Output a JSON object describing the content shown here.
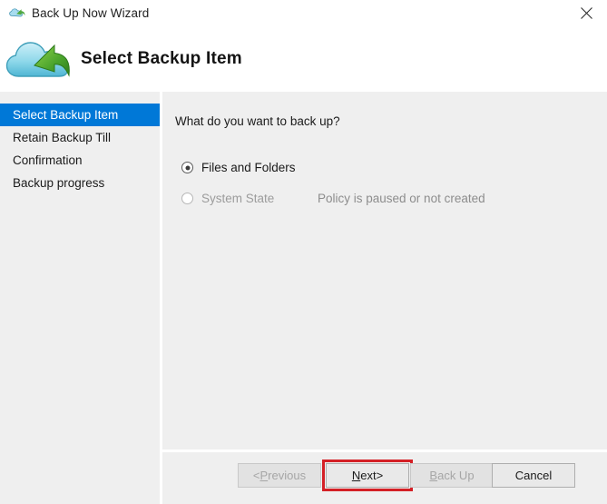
{
  "window": {
    "title": "Back Up Now Wizard",
    "title_icon": "cloud-backup-icon",
    "close_icon": "close-icon"
  },
  "header": {
    "icon": "cloud-download-arrow-icon",
    "title": "Select Backup Item"
  },
  "sidebar": {
    "active_index": 0,
    "items": [
      {
        "label": "Select Backup Item",
        "active": true
      },
      {
        "label": "Retain Backup Till",
        "active": false
      },
      {
        "label": "Confirmation",
        "active": false
      },
      {
        "label": "Backup progress",
        "active": false
      }
    ]
  },
  "content": {
    "question": "What do you want to back up?",
    "options": [
      {
        "label": "Files and Folders",
        "selected": true,
        "disabled": false,
        "note": ""
      },
      {
        "label": "System State",
        "selected": false,
        "disabled": true,
        "note": "Policy is paused or not created"
      }
    ]
  },
  "footer": {
    "buttons": [
      {
        "name": "previous",
        "prefix": "< ",
        "mnemonic": "P",
        "rest": "revious",
        "suffix": "",
        "disabled": true,
        "highlighted": false
      },
      {
        "name": "next",
        "prefix": "",
        "mnemonic": "N",
        "rest": "ext",
        "suffix": " >",
        "disabled": false,
        "highlighted": true
      },
      {
        "name": "backup",
        "prefix": "",
        "mnemonic": "B",
        "rest": "ack Up",
        "suffix": "",
        "disabled": true,
        "highlighted": false
      },
      {
        "name": "cancel",
        "prefix": "",
        "mnemonic": "",
        "rest": "Cancel",
        "suffix": "",
        "disabled": false,
        "highlighted": false
      }
    ]
  },
  "colors": {
    "accent": "#0078d7",
    "panel": "#efefef",
    "highlight_box": "#d42026",
    "disabled_text": "#a6a6a6",
    "note_text": "#8d8d8d"
  }
}
